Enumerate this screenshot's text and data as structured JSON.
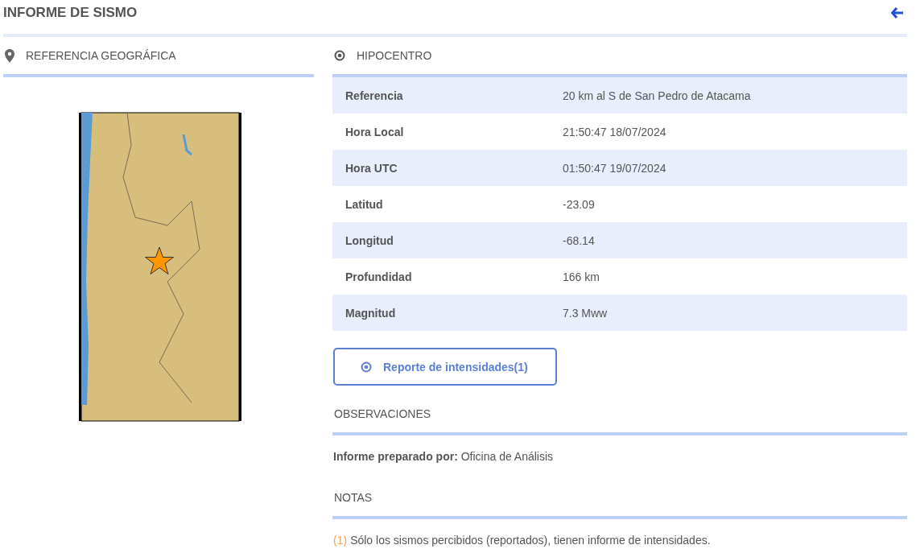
{
  "title": "INFORME DE SISMO",
  "geo_section": {
    "heading": "REFERENCIA GEOGRÁFICA"
  },
  "hypocenter_section": {
    "heading": "HIPOCENTRO",
    "rows": [
      {
        "label": "Referencia",
        "value": "20 km al S de San Pedro de Atacama"
      },
      {
        "label": "Hora Local",
        "value": "21:50:47 18/07/2024"
      },
      {
        "label": "Hora UTC",
        "value": "01:50:47 19/07/2024"
      },
      {
        "label": "Latitud",
        "value": "-23.09"
      },
      {
        "label": "Longitud",
        "value": "-68.14"
      },
      {
        "label": "Profundidad",
        "value": "166 km"
      },
      {
        "label": "Magnitud",
        "value": "7.3 Mww"
      }
    ]
  },
  "intensity_button": {
    "label": "Reporte de intensidades(1)"
  },
  "observations": {
    "heading": "OBSERVACIONES",
    "text": "**Informe preparado por:** Oficina de Análisis"
  },
  "notes": {
    "heading": "NOTAS",
    "items": [
      {
        "marker": "(1)",
        "text": "Sólo los sismos percibidos (reportados), tienen informe de intensidades."
      }
    ]
  }
}
